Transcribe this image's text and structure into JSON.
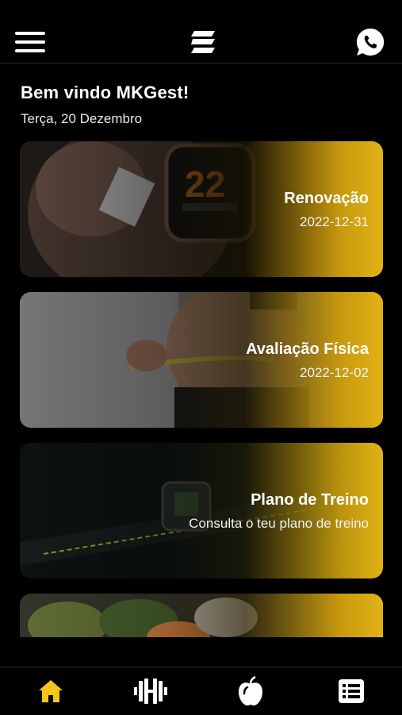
{
  "header": {
    "menu_icon": "hamburger-menu-icon",
    "logo_icon": "brand-logo-icon",
    "whatsapp_icon": "whatsapp-icon"
  },
  "welcome": {
    "greeting": "Bem vindo MKGest!",
    "date": "Terça, 20 Dezembro"
  },
  "cards": [
    {
      "title": "Renovação",
      "subtitle": "2022-12-31"
    },
    {
      "title": "Avaliação Física",
      "subtitle": "2022-12-02"
    },
    {
      "title": "Plano de Treino",
      "subtitle": "Consulta o teu plano de treino"
    },
    {
      "title": "",
      "subtitle": ""
    }
  ],
  "tabs": [
    {
      "icon": "home-icon",
      "active": true
    },
    {
      "icon": "dumbbell-icon",
      "active": false
    },
    {
      "icon": "apple-icon",
      "active": false
    },
    {
      "icon": "list-icon",
      "active": false
    }
  ],
  "colors": {
    "accent": "#F5C518",
    "background": "#000000"
  }
}
